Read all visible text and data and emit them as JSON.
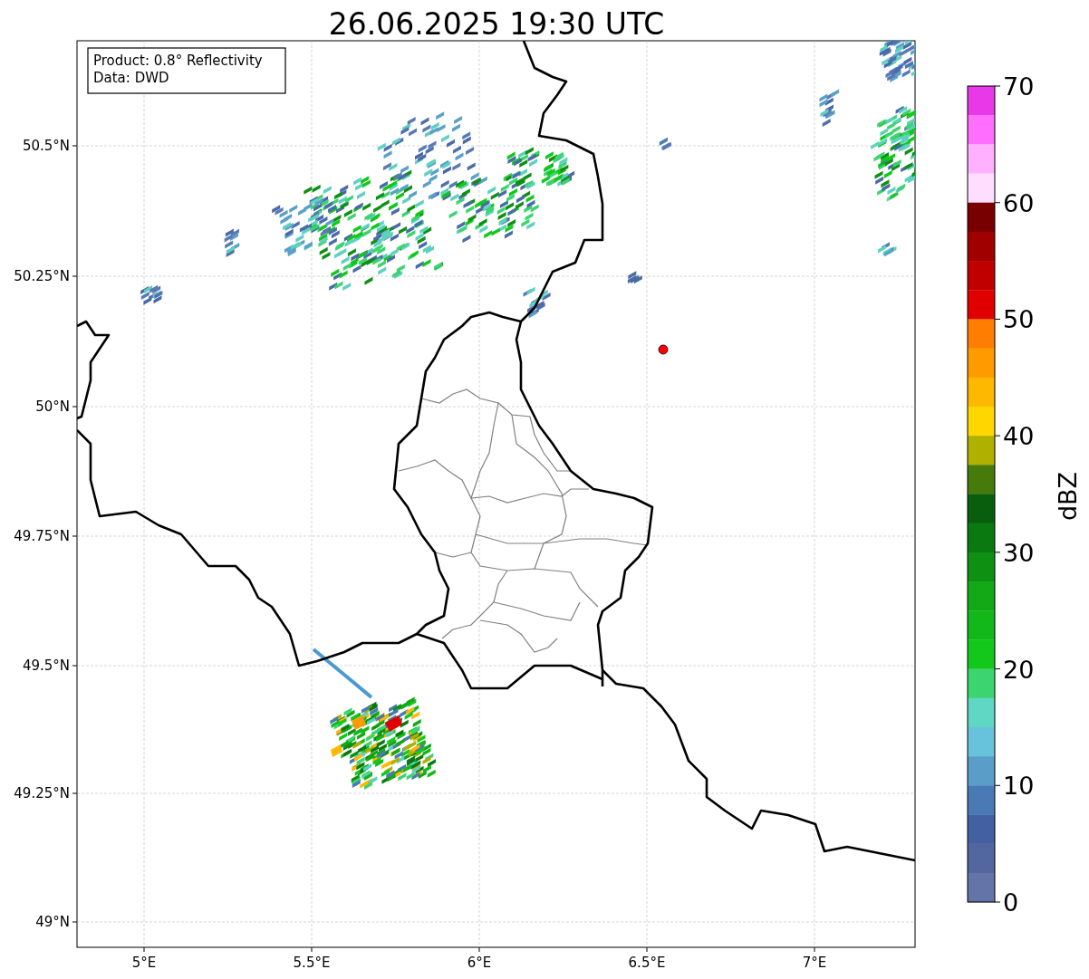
{
  "title": "26.06.2025 19:30 UTC",
  "info_box": {
    "lines": [
      "Product: 0.8° Reflectivity",
      "Data: DWD"
    ]
  },
  "x_axis": {
    "ticks": [
      "5°E",
      "5.5°E",
      "6°E",
      "6.5°E",
      "7°E"
    ]
  },
  "y_axis": {
    "ticks": [
      "50.5°N",
      "50.25°N",
      "50°N",
      "49.75°N",
      "49.5°N",
      "49.25°N",
      "49°N"
    ]
  },
  "colorbar": {
    "label": "dBZ",
    "ticks": [
      "70",
      "60",
      "50",
      "40",
      "30",
      "20",
      "10",
      "0"
    ],
    "bands": [
      {
        "color": "#e838e8"
      },
      {
        "color": "#ff6eff"
      },
      {
        "color": "#ffb0ff"
      },
      {
        "color": "#ffddff"
      },
      {
        "color": "#780000"
      },
      {
        "color": "#a00000"
      },
      {
        "color": "#c00000"
      },
      {
        "color": "#e00000"
      },
      {
        "color": "#ff7d00"
      },
      {
        "color": "#ff9a00"
      },
      {
        "color": "#ffb800"
      },
      {
        "color": "#ffd700"
      },
      {
        "color": "#b0b000"
      },
      {
        "color": "#467a0a"
      },
      {
        "color": "#085e0c"
      },
      {
        "color": "#0a7a10"
      },
      {
        "color": "#0e9013"
      },
      {
        "color": "#12a816"
      },
      {
        "color": "#12b81a"
      },
      {
        "color": "#12c81b"
      },
      {
        "color": "#3cd46f"
      },
      {
        "color": "#5fd7c4"
      },
      {
        "color": "#67c3dc"
      },
      {
        "color": "#5a9dc8"
      },
      {
        "color": "#4a7ab5"
      },
      {
        "color": "#4360a3"
      },
      {
        "color": "#52679f"
      },
      {
        "color": "#6474a8"
      }
    ]
  }
}
